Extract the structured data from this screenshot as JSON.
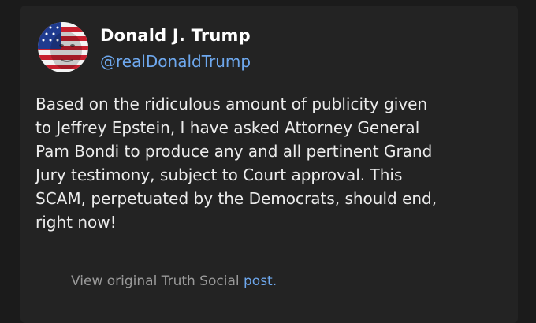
{
  "author": {
    "display_name": "Donald J. Trump",
    "handle": "@realDonaldTrump",
    "avatar_icon": "flag-face-avatar"
  },
  "post": {
    "text": "Based on the ridiculous amount of publicity given\nto Jeffrey Epstein, I have asked Attorney General\nPam Bondi to produce any and all pertinent Grand\nJury testimony, subject to Court approval. This\nSCAM, perpetuated by the Democrats, should end,\nright now!"
  },
  "footer": {
    "prefix": "View original Truth Social ",
    "link_label": "post."
  },
  "colors": {
    "background": "#1b1b1b",
    "card": "#232323",
    "link": "#6ea8ee",
    "text": "#ececec"
  }
}
